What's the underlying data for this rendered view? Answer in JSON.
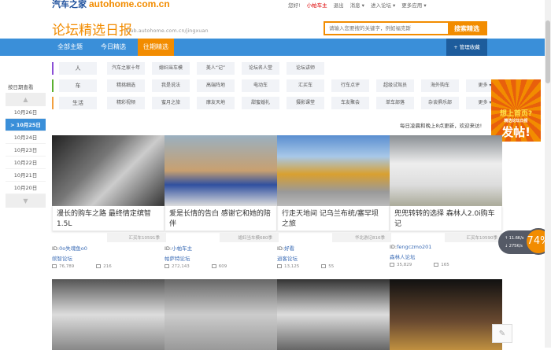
{
  "topbar": {
    "logo_cn": "汽车之家",
    "logo_domain": "autohome.com.cn",
    "greeting": "您好!",
    "username": "小帕车主",
    "logout": "退出",
    "messages": "消息 ▾",
    "enter_forum": "进入论坛 ▾",
    "more_apps": "更多应用 ▾"
  },
  "header": {
    "title": "论坛精选日报",
    "url": "club.autohome.com.cn/jingxuan",
    "search_placeholder": "请输入您要搜的关键字，例如福克斯",
    "search_button": "搜索精选"
  },
  "nav": {
    "tabs": [
      {
        "label": "全部主题"
      },
      {
        "label": "今日精选"
      },
      {
        "label": "往期精选"
      }
    ],
    "manage": "+ 管理收藏"
  },
  "categories": [
    {
      "label": "人",
      "color": "#8a4fd6",
      "items": [
        "汽车之家十年",
        "媳妇当车模",
        "美人“记”",
        "论坛名人堂",
        "论坛讲师"
      ]
    },
    {
      "label": "车",
      "color": "#5cb030",
      "items": [
        "精挑细选",
        "我是说法",
        "高端阵地",
        "电动车",
        "汇买车",
        "行车点评",
        "超级试驾员",
        "海外购车",
        "更多 ▾"
      ]
    },
    {
      "label": "生活",
      "color": "#f2a040",
      "items": [
        "精彩视频",
        "蜜月之旅",
        "摩友天地",
        "甜蜜婚礼",
        "摄影课堂",
        "车友聚会",
        "单车部落",
        "杂谈俱乐部",
        "更多 ▾"
      ]
    }
  ],
  "sidebar": {
    "title": "按日期查看",
    "dates": [
      "10月26日",
      "> 10月25日",
      "10月24日",
      "10月23日",
      "10月22日",
      "10月21日",
      "10月20日"
    ],
    "active_index": 1
  },
  "notice": "每日凌晨和晚上8点更新，欢迎来访!",
  "ad": {
    "line1": "想上首页?",
    "line2": "精选论坛日报",
    "line3": "发帖!"
  },
  "cards": [
    {
      "title": "漫长的购车之路 最终情定缤智1.5L",
      "tag": "汇买车10591季",
      "id_prefix": "ID:",
      "user": "0o失魂鱼o0",
      "forum": "缤智论坛",
      "views": "76,789",
      "replies": "216",
      "img": "linear-gradient(135deg,#222,#777 40%,#ccc 60%,#333)"
    },
    {
      "title": "爱是长情的告白 感谢它和她的陪伴",
      "tag": "媳妇当车模680季",
      "id_prefix": "ID:",
      "user": "小帕车主",
      "forum": "帕萨特论坛",
      "views": "272,143",
      "replies": "609",
      "img": "linear-gradient(180deg,#9ab0c0,#c8a070 50%,#3050a0 70%,#ddd)"
    },
    {
      "title": "行走天地间 记乌兰布统/塞罕坝之旅",
      "tag": "华北游记816季",
      "id_prefix": "ID:",
      "user": "好看",
      "forum": "逍客论坛",
      "views": "13,125",
      "replies": "55",
      "img": "linear-gradient(180deg,#5a8ed0,#a8c8e8 30%,#d9a030 55%,#999 80%,#bbb)"
    },
    {
      "title": "兜兜转转的选择 森林人2.0i购车记",
      "tag": "汇买车10590季",
      "id_prefix": "ID:",
      "user": "fengczmo201",
      "forum": "森林人论坛",
      "views": "35,829",
      "replies": "165",
      "img": "linear-gradient(180deg,#8a8f94,#eee 40%,#ddd 70%,#aa9)"
    }
  ],
  "row2_imgs": [
    "linear-gradient(180deg,#555,#ddd 50%,#888)",
    "linear-gradient(180deg,#666,#ccc 50%,#999)",
    "linear-gradient(180deg,#333,#ddd 50%,#666)",
    "linear-gradient(180deg,#111,#6a4a30 60%,#c09040)"
  ],
  "speed": {
    "up": "↑ 11.6K/s",
    "down": "↓ 275K/s",
    "percent": "74%"
  },
  "colors": {
    "accent": "#f28c00",
    "nav_blue": "#3a8fd9"
  }
}
